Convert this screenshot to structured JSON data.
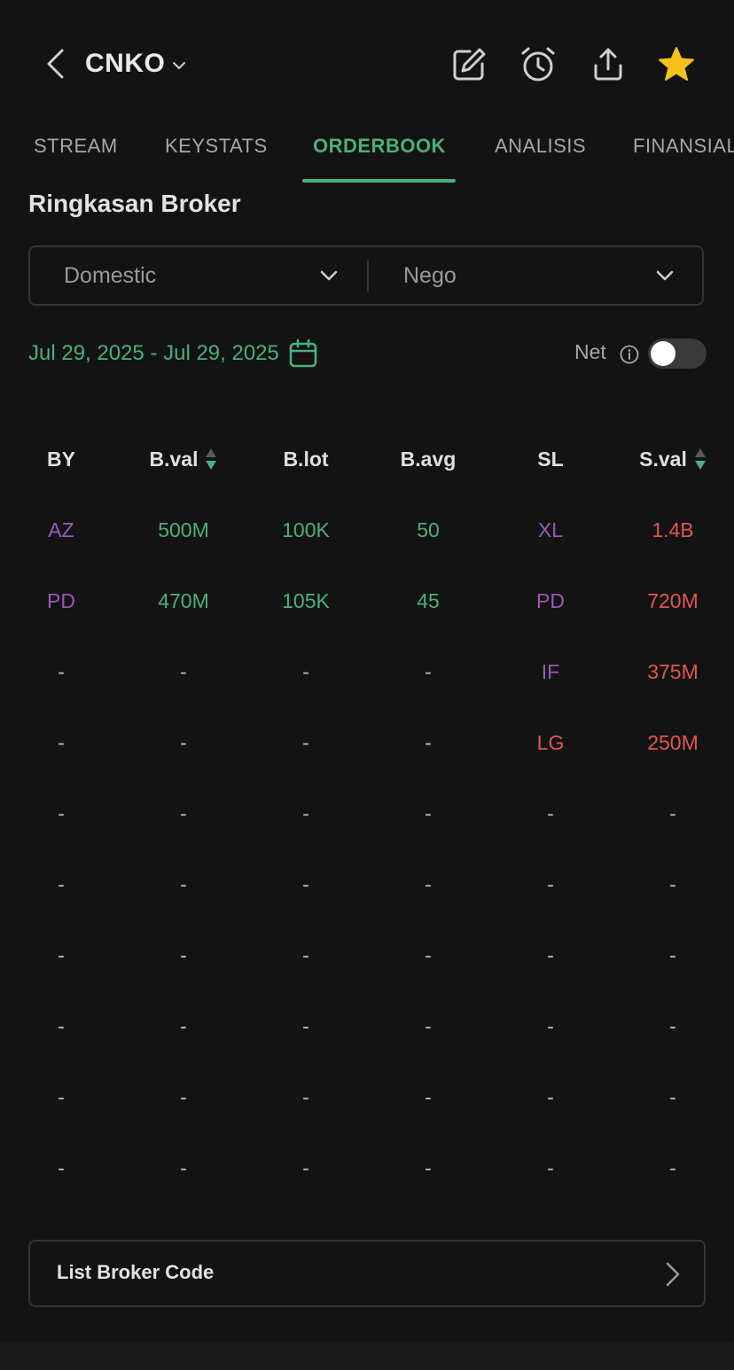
{
  "header": {
    "ticker": "CNKO",
    "icons": [
      "back-icon",
      "chevron-down-icon",
      "edit-icon",
      "alarm-icon",
      "share-icon",
      "star-icon"
    ]
  },
  "tabs": [
    {
      "label": "STREAM",
      "active": false
    },
    {
      "label": "KEYSTATS",
      "active": false
    },
    {
      "label": "ORDERBOOK",
      "active": true
    },
    {
      "label": "ANALISIS",
      "active": false
    },
    {
      "label": "FINANSIAL",
      "active": false
    }
  ],
  "section_title": "Ringkasan Broker",
  "filters": {
    "investor": "Domestic",
    "market": "Nego"
  },
  "date_range": "Jul 29, 2025 - Jul 29, 2025",
  "net": {
    "label": "Net",
    "enabled": false
  },
  "table": {
    "headers": [
      "BY",
      "B.val",
      "B.lot",
      "B.avg",
      "SL",
      "S.val"
    ],
    "rows": [
      [
        "AZ",
        "500M",
        "100K",
        "50",
        "XL",
        "1.4B"
      ],
      [
        "PD",
        "470M",
        "105K",
        "45",
        "PD",
        "720M"
      ],
      [
        "-",
        "-",
        "-",
        "-",
        "IF",
        "375M"
      ],
      [
        "-",
        "-",
        "-",
        "-",
        "LG",
        "250M"
      ],
      [
        "-",
        "-",
        "-",
        "-",
        "-",
        "-"
      ],
      [
        "-",
        "-",
        "-",
        "-",
        "-",
        "-"
      ],
      [
        "-",
        "-",
        "-",
        "-",
        "-",
        "-"
      ],
      [
        "-",
        "-",
        "-",
        "-",
        "-",
        "-"
      ],
      [
        "-",
        "-",
        "-",
        "-",
        "-",
        "-"
      ],
      [
        "-",
        "-",
        "-",
        "-",
        "-",
        "-"
      ]
    ]
  },
  "list_broker_code": "List Broker Code",
  "colors": {
    "accent_green": "#4caf7a",
    "sell_red": "#e0574f",
    "broker_purple": "#9b59b6",
    "star_yellow": "#f6c21a",
    "background": "#131313"
  }
}
